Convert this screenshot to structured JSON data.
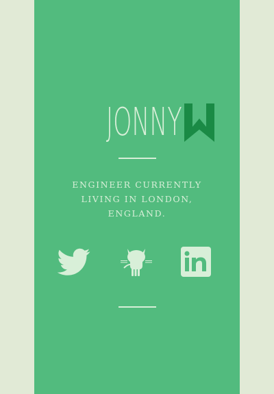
{
  "brand": {
    "name": "JONNY",
    "mark_icon": "w-ribbon-icon"
  },
  "tagline": "ENGINEER CURRENTLY LIVING IN LONDON, ENGLAND.",
  "social": [
    {
      "icon": "twitter-icon"
    },
    {
      "icon": "github-icon"
    },
    {
      "icon": "linkedin-icon"
    }
  ],
  "colors": {
    "background": "#e1ead6",
    "panel": "#52bb7e",
    "text": "#d8efd8",
    "accent": "#1a8a45"
  }
}
